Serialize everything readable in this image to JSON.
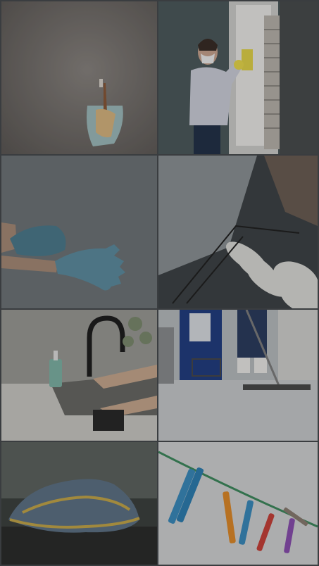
{
  "collage": {
    "tiles": [
      {
        "subject": "dustpan-and-brush-on-wall-hook"
      },
      {
        "subject": "person-in-mask-cleaning-window-shutters"
      },
      {
        "subject": "hands-putting-on-blue-gloves"
      },
      {
        "subject": "dishwasher-rack-with-plates"
      },
      {
        "subject": "hands-washing-at-kitchen-sink"
      },
      {
        "subject": "mopping-floor"
      },
      {
        "subject": "folded-microfiber-cloth"
      },
      {
        "subject": "clothespins-on-line"
      }
    ]
  }
}
